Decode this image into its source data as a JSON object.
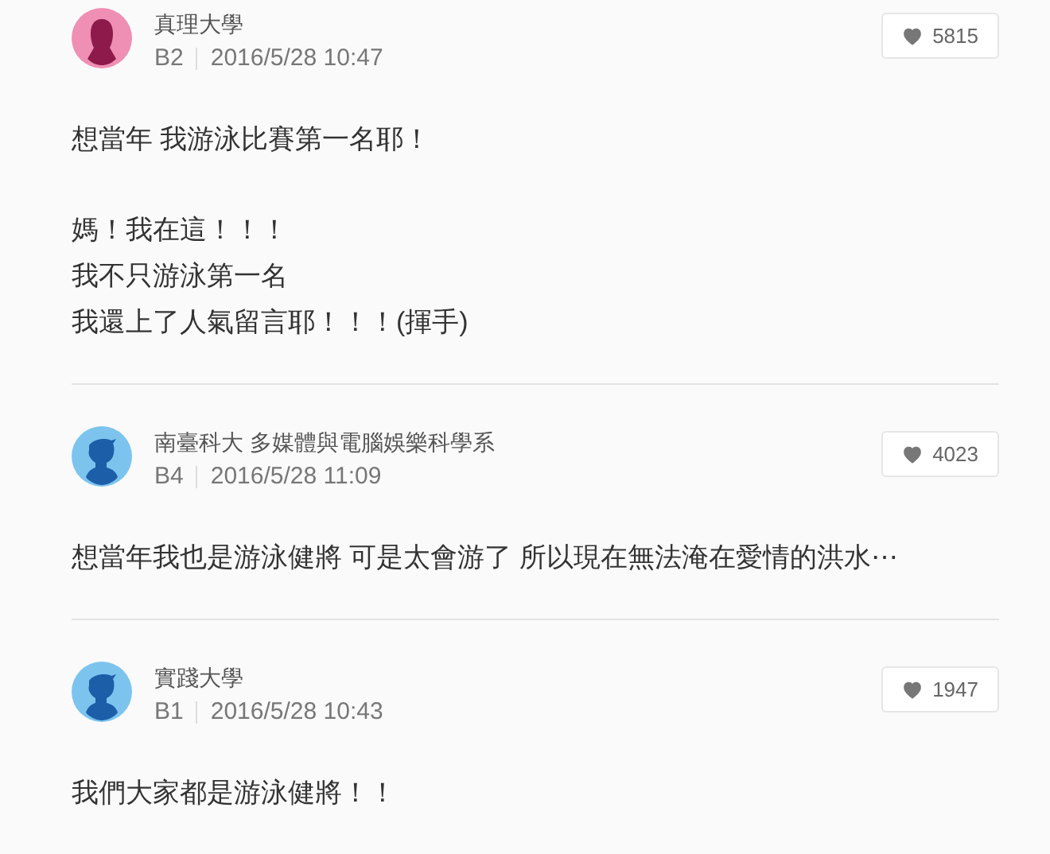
{
  "comments": [
    {
      "avatar": {
        "kind": "female"
      },
      "school": "真理大學",
      "floor": "B2",
      "time": "2016/5/28 10:47",
      "likes": "5815",
      "paragraphs": [
        [
          "想當年 我游泳比賽第一名耶！"
        ],
        [
          "媽！我在這！！！",
          "我不只游泳第一名",
          "我還上了人氣留言耶！！！(揮手)"
        ]
      ]
    },
    {
      "avatar": {
        "kind": "male"
      },
      "school": "南臺科大 多媒體與電腦娛樂科學系",
      "floor": "B4",
      "time": "2016/5/28 11:09",
      "likes": "4023",
      "paragraphs": [
        [
          "想當年我也是游泳健將 可是太會游了 所以現在無法淹在愛情的洪水⋯"
        ]
      ]
    },
    {
      "avatar": {
        "kind": "male"
      },
      "school": "實踐大學",
      "floor": "B1",
      "time": "2016/5/28 10:43",
      "likes": "1947",
      "paragraphs": [
        [
          "我們大家都是游泳健將！！"
        ]
      ]
    }
  ]
}
